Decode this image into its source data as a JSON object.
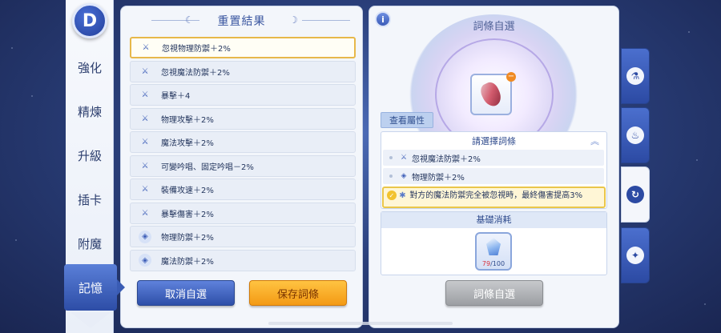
{
  "nav": {
    "back_glyph": "D",
    "items": [
      "強化",
      "精煉",
      "升級",
      "插卡",
      "附魔",
      "記憶"
    ],
    "active_index": 5
  },
  "left_panel": {
    "title": "重置結果",
    "rows": [
      {
        "icon": "sword-icon",
        "text": "忽視物理防禦＋2%",
        "selected": true
      },
      {
        "icon": "sword-icon",
        "text": "忽視魔法防禦＋2%"
      },
      {
        "icon": "sword-icon",
        "text": "暴擊＋4"
      },
      {
        "icon": "sword-icon",
        "text": "物理攻擊＋2%"
      },
      {
        "icon": "sword-icon",
        "text": "魔法攻擊＋2%"
      },
      {
        "icon": "sword-icon",
        "text": "可變吟唱、固定吟唱－2%"
      },
      {
        "icon": "sword-icon",
        "text": "裝備攻速＋2%"
      },
      {
        "icon": "sword-icon",
        "text": "暴擊傷害＋2%"
      },
      {
        "icon": "shield-icon",
        "text": "物理防禦＋2%"
      },
      {
        "icon": "shield-icon",
        "text": "魔法防禦＋2%"
      }
    ],
    "cancel_label": "取消自選",
    "save_label": "保存詞條"
  },
  "right_panel": {
    "info_glyph": "i",
    "title": "詞條自選",
    "remove_glyph": "−",
    "view_attr_label": "查看屬性",
    "select_title": "請選擇詞條",
    "options": [
      {
        "icon": "sword-icon",
        "text": "忽視魔法防禦＋2%"
      },
      {
        "icon": "shield-icon",
        "text": "物理防禦＋2%"
      }
    ],
    "desc_text": "對方的魔法防禦完全被忽視時，最終傷害提高3%",
    "cost_title": "基礎消耗",
    "cost_have": "79",
    "cost_need": "/100",
    "choose_label": "詞條自選"
  },
  "right_tabs": [
    {
      "icon": "potion-icon",
      "glyph": "⚗",
      "active": false
    },
    {
      "icon": "flask-icon",
      "glyph": "♨",
      "active": false
    },
    {
      "icon": "refresh-icon",
      "glyph": "↻",
      "active": true
    },
    {
      "icon": "sparkle-icon",
      "glyph": "✦",
      "active": false
    }
  ],
  "colors": {
    "accent_blue": "#2d4da6",
    "save_orange": "#f39a14",
    "selected_border": "#e7b84a",
    "cost_have_red": "#d8323c"
  }
}
